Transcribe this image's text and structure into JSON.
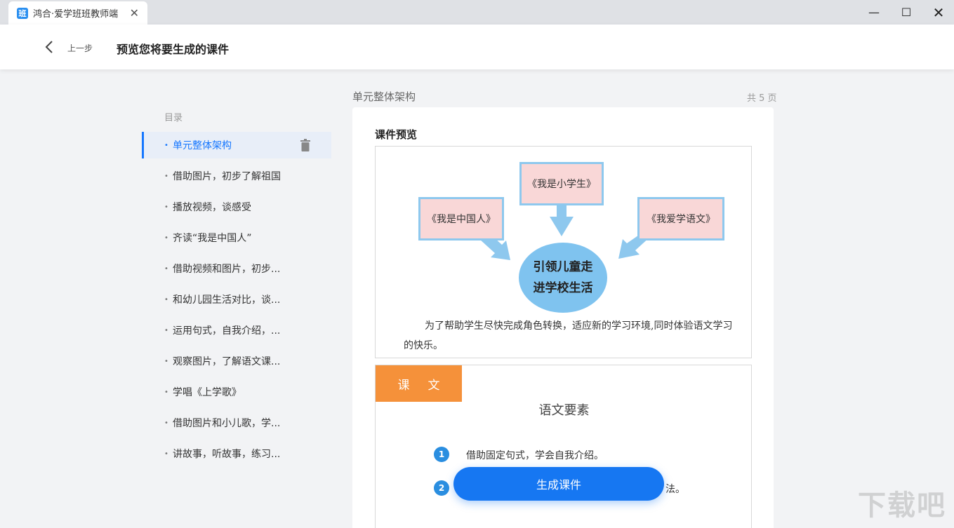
{
  "window": {
    "tab_title": "鸿合·爱学班班教师端",
    "logo_char": "班",
    "tab_close": "✕",
    "minimize": "—",
    "maximize": "☐",
    "close": "✕"
  },
  "header": {
    "back_label": "上一步",
    "title": "预览您将要生成的课件"
  },
  "toc": {
    "title": "目录",
    "items": [
      {
        "label": "单元整体架构",
        "active": true
      },
      {
        "label": "借助图片，初步了解祖国"
      },
      {
        "label": "播放视频，谈感受"
      },
      {
        "label": "齐读“我是中国人”"
      },
      {
        "label": "借助视频和图片，初步..."
      },
      {
        "label": "和幼儿园生活对比，谈..."
      },
      {
        "label": "运用句式，自我介绍，..."
      },
      {
        "label": "观察图片，了解语文课..."
      },
      {
        "label": "学唱《上学歌》"
      },
      {
        "label": "借助图片和小儿歌，学..."
      },
      {
        "label": "讲故事，听故事，练习..."
      }
    ]
  },
  "preview": {
    "section_name": "单元整体架构",
    "page_count": "共 5 页",
    "card_title": "课件预览",
    "slide1": {
      "box_top": "《我是小学生》",
      "box_left": "《我是中国人》",
      "box_right": "《我爱学语文》",
      "center_line1": "引领儿童走",
      "center_line2": "进学校生活",
      "caption": "为了帮助学生尽快完成角色转换，适应新的学习环境,同时体验语文学习的快乐。"
    },
    "slide2": {
      "label": "课文",
      "title": "语文要素",
      "points": [
        {
          "num": "1",
          "text": "借助固定句式，学会自我介绍。"
        },
        {
          "num": "2",
          "text": "法。"
        }
      ]
    }
  },
  "actions": {
    "generate": "生成课件"
  },
  "watermark": "下载吧",
  "colors": {
    "accent": "#1677f2",
    "orange": "#f5913a",
    "pink_box": "#f9d7d7",
    "blue_border": "#8ec8ee",
    "circle": "#7fc3ef"
  }
}
